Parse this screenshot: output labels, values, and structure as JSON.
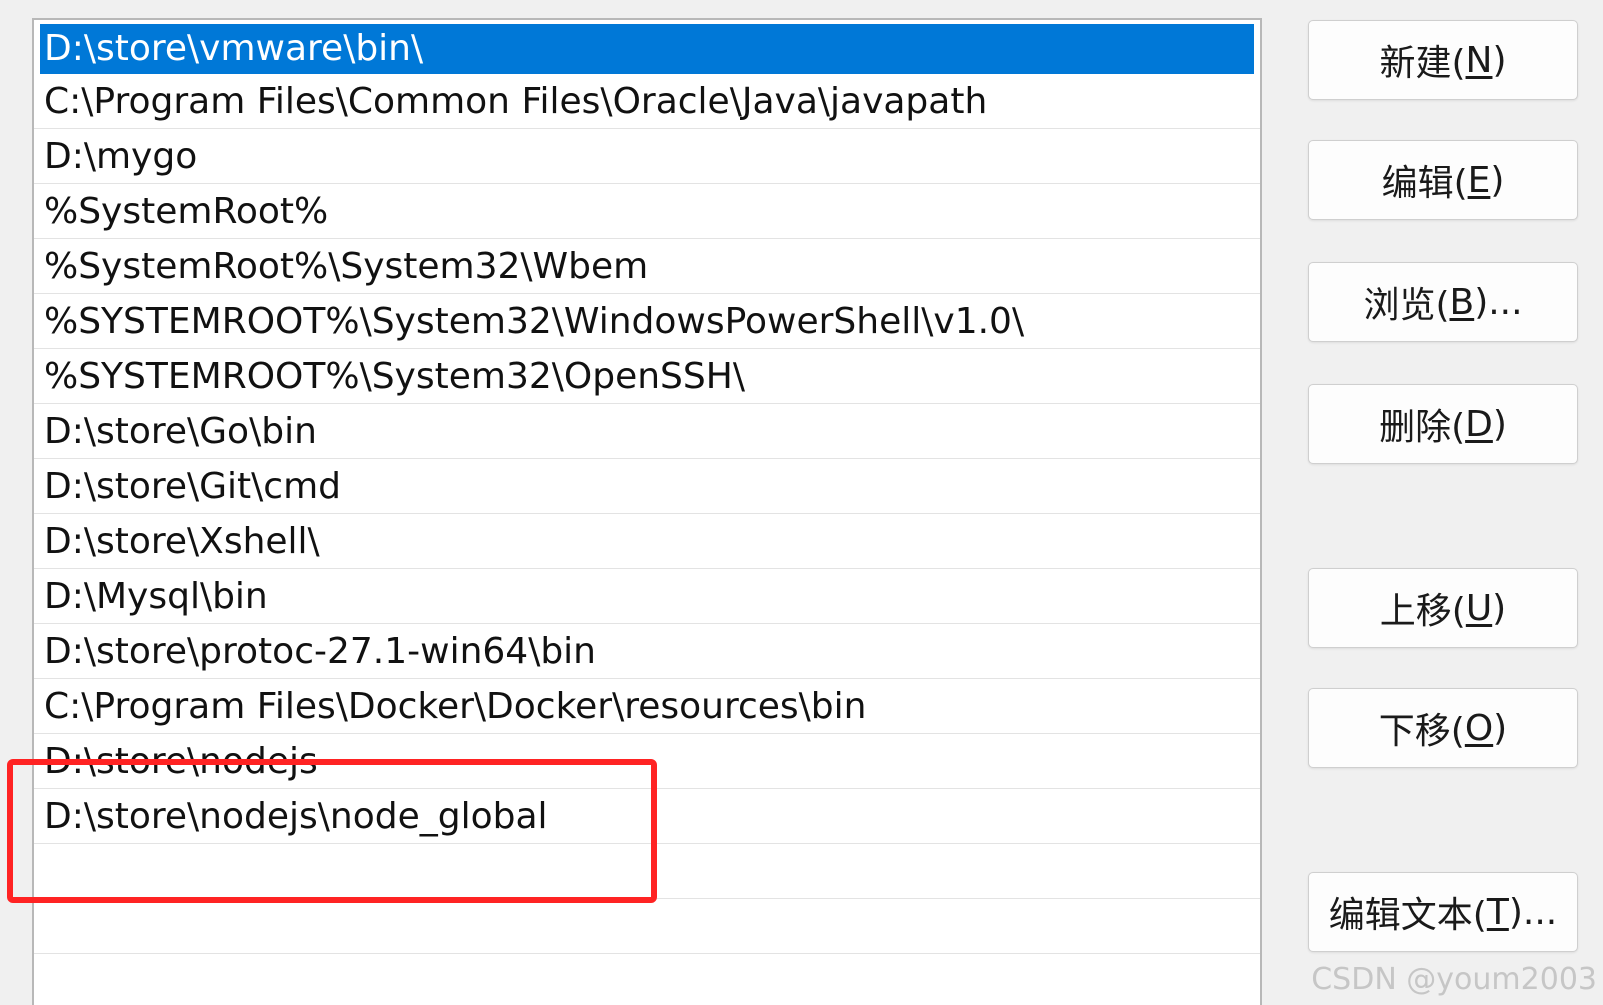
{
  "path_list": {
    "items": [
      {
        "text": "D:\\store\\vmware\\bin\\",
        "selected": true
      },
      {
        "text": "C:\\Program Files\\Common Files\\Oracle\\Java\\javapath",
        "selected": false
      },
      {
        "text": "D:\\mygo",
        "selected": false
      },
      {
        "text": "%SystemRoot%",
        "selected": false
      },
      {
        "text": "%SystemRoot%\\System32\\Wbem",
        "selected": false
      },
      {
        "text": "%SYSTEMROOT%\\System32\\WindowsPowerShell\\v1.0\\",
        "selected": false
      },
      {
        "text": "%SYSTEMROOT%\\System32\\OpenSSH\\",
        "selected": false
      },
      {
        "text": "D:\\store\\Go\\bin",
        "selected": false
      },
      {
        "text": "D:\\store\\Git\\cmd",
        "selected": false
      },
      {
        "text": "D:\\store\\Xshell\\",
        "selected": false
      },
      {
        "text": "D:\\Mysql\\bin",
        "selected": false
      },
      {
        "text": "D:\\store\\protoc-27.1-win64\\bin",
        "selected": false
      },
      {
        "text": "C:\\Program Files\\Docker\\Docker\\resources\\bin",
        "selected": false
      },
      {
        "text": "D:\\store\\nodejs",
        "selected": false
      },
      {
        "text": "D:\\store\\nodejs\\node_global",
        "selected": false
      }
    ]
  },
  "buttons": {
    "new": {
      "pre": "新建(",
      "mnemonic": "N",
      "post": ")"
    },
    "edit": {
      "pre": "编辑(",
      "mnemonic": "E",
      "post": ")"
    },
    "browse": {
      "pre": "浏览(",
      "mnemonic": "B",
      "post": ")..."
    },
    "delete": {
      "pre": "删除(",
      "mnemonic": "D",
      "post": ")"
    },
    "move_up": {
      "pre": "上移(",
      "mnemonic": "U",
      "post": ")"
    },
    "move_down": {
      "pre": "下移(",
      "mnemonic": "O",
      "post": ")"
    },
    "edit_text": {
      "pre": "编辑文本(",
      "mnemonic": "T",
      "post": ")..."
    }
  },
  "watermark": "CSDN @youm2003",
  "colors": {
    "selection": "#0078d7",
    "highlight_box": "#ff2323",
    "window_bg": "#f0f0f0"
  }
}
